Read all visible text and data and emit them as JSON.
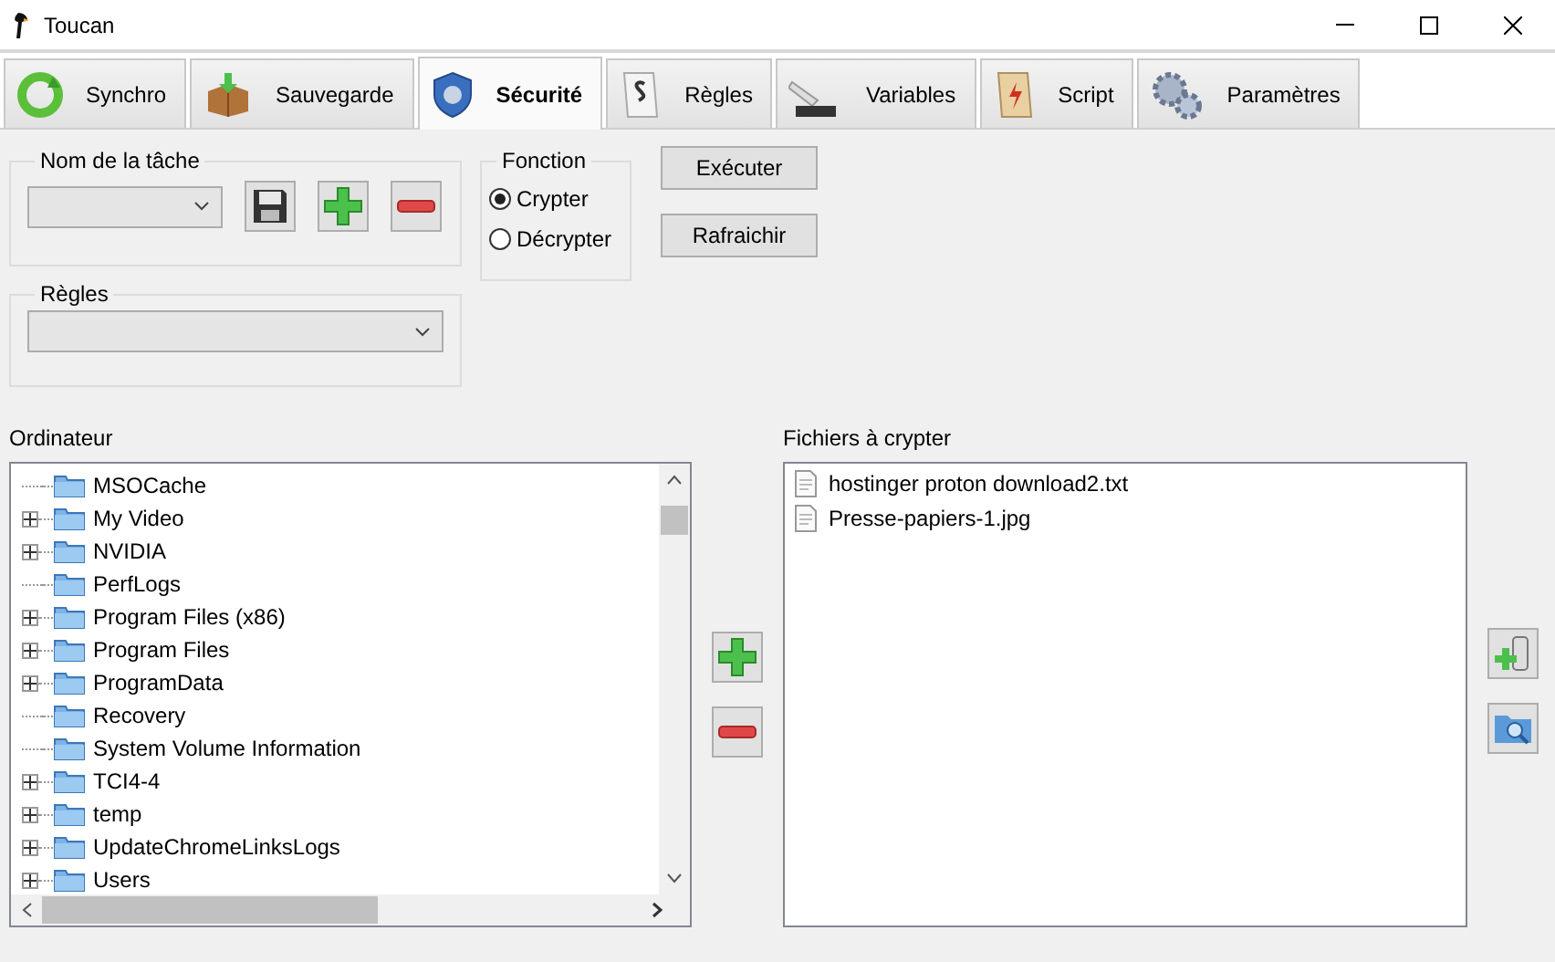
{
  "window": {
    "title": "Toucan"
  },
  "tabs": [
    {
      "label": "Synchro",
      "selected": false,
      "kind": "sync"
    },
    {
      "label": "Sauvegarde",
      "selected": false,
      "kind": "backup"
    },
    {
      "label": "Sécurité",
      "selected": true,
      "kind": "security"
    },
    {
      "label": "Règles",
      "selected": false,
      "kind": "rules"
    },
    {
      "label": "Variables",
      "selected": false,
      "kind": "variables"
    },
    {
      "label": "Script",
      "selected": false,
      "kind": "script"
    },
    {
      "label": "Paramètres",
      "selected": false,
      "kind": "settings"
    }
  ],
  "task_group": {
    "title": "Nom de la tâche"
  },
  "rules_group": {
    "title": "Règles"
  },
  "function_group": {
    "title": "Fonction",
    "options": [
      {
        "label": "Crypter",
        "selected": true
      },
      {
        "label": "Décrypter",
        "selected": false
      }
    ]
  },
  "actions": [
    "Exécuter",
    "Rafraichir"
  ],
  "computer": {
    "label": "Ordinateur",
    "items": [
      {
        "name": "MSOCache",
        "expandable": false
      },
      {
        "name": "My Video",
        "expandable": true
      },
      {
        "name": "NVIDIA",
        "expandable": true
      },
      {
        "name": "PerfLogs",
        "expandable": false
      },
      {
        "name": "Program Files (x86)",
        "expandable": true
      },
      {
        "name": "Program Files",
        "expandable": true
      },
      {
        "name": "ProgramData",
        "expandable": true
      },
      {
        "name": "Recovery",
        "expandable": false
      },
      {
        "name": "System Volume Information",
        "expandable": false
      },
      {
        "name": "TCI4-4",
        "expandable": true
      },
      {
        "name": "temp",
        "expandable": true
      },
      {
        "name": "UpdateChromeLinksLogs",
        "expandable": true
      },
      {
        "name": "Users",
        "expandable": true
      }
    ]
  },
  "files": {
    "label": "Fichiers à crypter",
    "items": [
      "hostinger proton download2.txt",
      "Presse-papiers-1.jpg"
    ]
  }
}
